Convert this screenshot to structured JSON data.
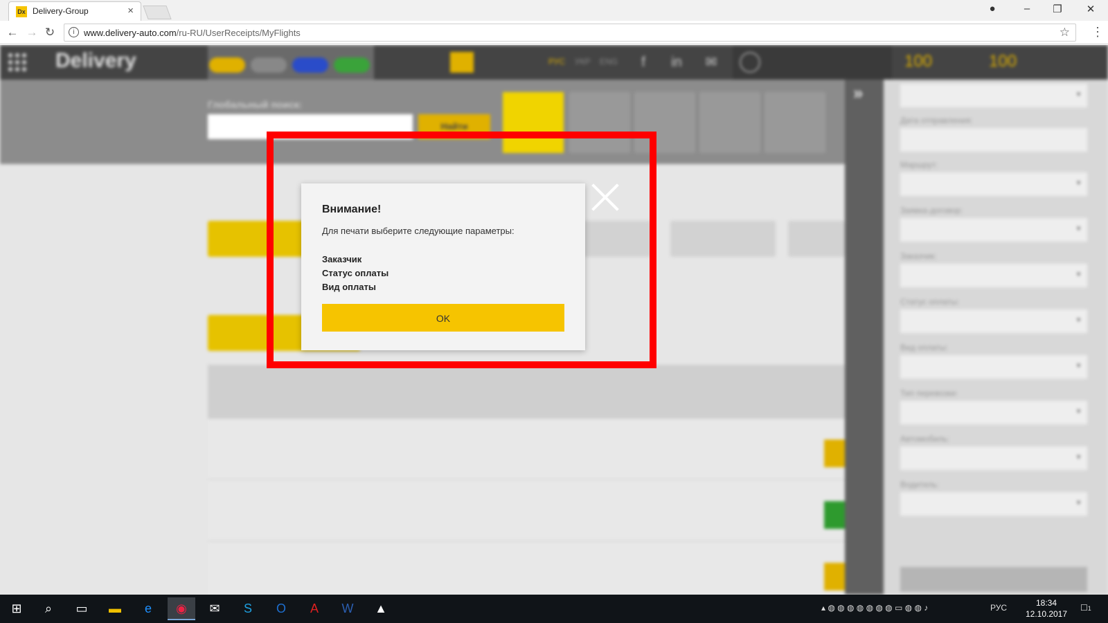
{
  "browser": {
    "tab_title": "Delivery-Group",
    "favicon_text": "Dx",
    "tab_close": "×",
    "url_domain": "www.delivery-auto.com",
    "url_path": "/ru-RU/UserReceipts/MyFlights"
  },
  "app": {
    "languages": [
      "РУС",
      "УКР",
      "ENG"
    ],
    "balance_1": "100",
    "balance_2": "100",
    "global_search_label": "Глобальный поиск:",
    "find_button": "Найти"
  },
  "dialog": {
    "title": "Внимание!",
    "message": "Для печати выберите следующие параметры:",
    "params": [
      "Заказчик",
      "Статус оплаты",
      "Вид оплаты"
    ],
    "ok_label": "OK"
  },
  "filters": {
    "labels": [
      "Дата отправления:",
      "Маршрут:",
      "Заявка-договор:",
      "Заказчик:",
      "Статус оплаты:",
      "Вид оплаты:",
      "Тип перевозки:",
      "Автомобиль:",
      "Водитель:"
    ]
  },
  "taskbar": {
    "lang": "РУС",
    "time": "18:34",
    "date": "12.10.2017",
    "notifications": "1"
  },
  "colors": {
    "accent_yellow": "#f6c400",
    "highlight_red": "#ff0000"
  }
}
